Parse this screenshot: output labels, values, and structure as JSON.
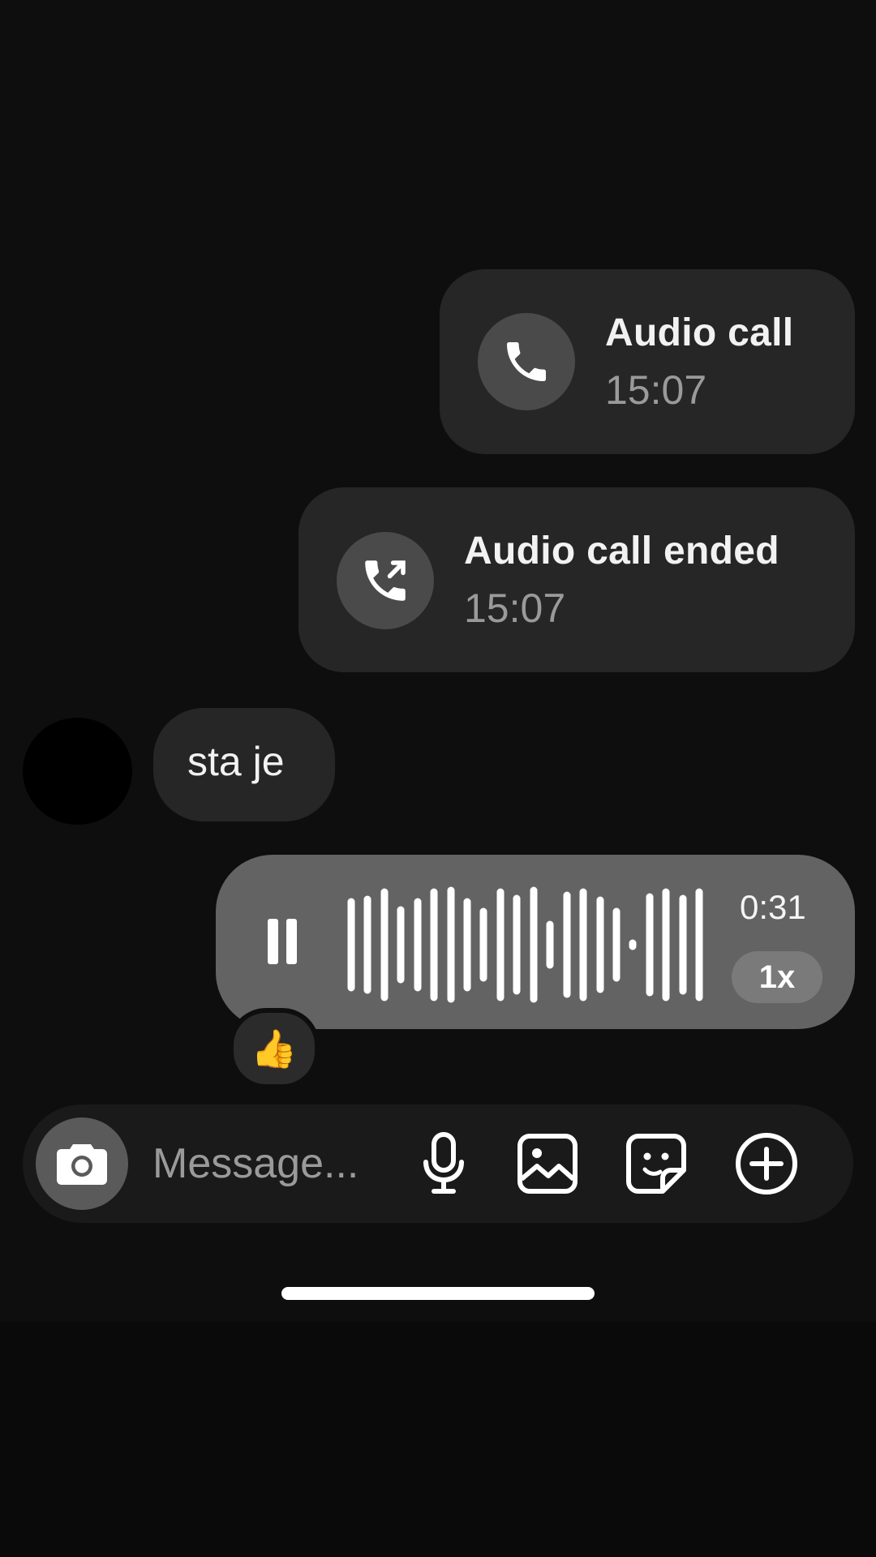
{
  "messages": {
    "call_1": {
      "title": "Audio call",
      "time": "15:07",
      "icon": "phone-icon"
    },
    "call_2": {
      "title": "Audio call ended",
      "time": "15:07",
      "icon": "phone-outgoing-icon"
    },
    "received": {
      "text": "sta je"
    },
    "voice": {
      "duration": "0:31",
      "speed": "1x",
      "state": "playing",
      "reaction": "👍"
    }
  },
  "composer": {
    "placeholder": "Message...",
    "icons": [
      "camera-icon",
      "microphone-icon",
      "image-icon",
      "sticker-icon",
      "plus-circle-icon"
    ]
  },
  "colors": {
    "background": "#0e0e0e",
    "bubble": "#262626",
    "voice_bubble": "#636363",
    "text_secondary": "#9a9a9a"
  }
}
